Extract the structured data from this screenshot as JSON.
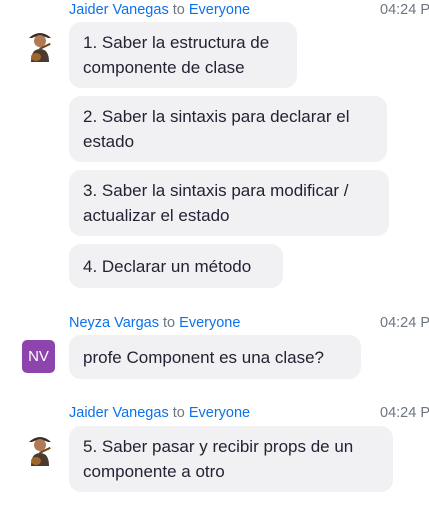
{
  "groups": [
    {
      "sender": "Jaider Vanegas",
      "to": "to",
      "recipient": "Everyone",
      "time": "04:24 P",
      "avatar": "person-with-guitar-icon",
      "messages": [
        "1. Saber la estructura de componente de clase",
        "2. Saber la sintaxis para declarar el estado",
        "3. Saber la sintaxis para modificar / actualizar el estado",
        "4. Declarar un método"
      ]
    },
    {
      "sender": "Neyza Vargas",
      "to": "to",
      "recipient": "Everyone",
      "time": "04:24 P",
      "avatar_initials": "NV",
      "avatar_color": "#8e44ad",
      "messages": [
        "profe Component es una clase?"
      ]
    },
    {
      "sender": "Jaider Vanegas",
      "to": "to",
      "recipient": "Everyone",
      "time": "04:24 P",
      "avatar": "person-with-guitar-icon",
      "messages": [
        "5. Saber pasar y recibir props de un componente a otro"
      ]
    }
  ],
  "colors": {
    "link": "#0e71eb",
    "bubble": "#f1f1f4",
    "muted": "#6e7680"
  }
}
